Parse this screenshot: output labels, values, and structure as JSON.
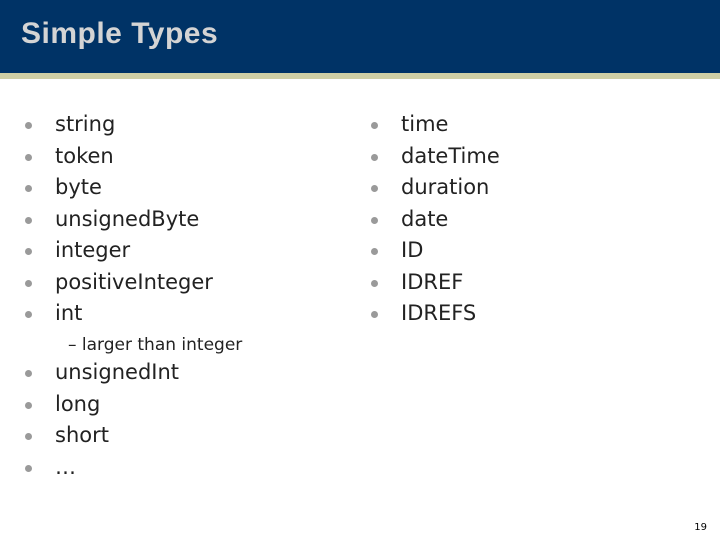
{
  "slide": {
    "title": "Simple Types",
    "page_number": "19",
    "colors": {
      "header": "#003366",
      "stripe": "#cfcfa5",
      "title": "#d4d4d4",
      "bullet": "#9a9a9a"
    }
  },
  "left_list": {
    "items": [
      "string",
      "token",
      "byte",
      "unsignedByte",
      "integer",
      "positiveInteger",
      "int"
    ],
    "sub_item": "– larger than integer",
    "items_after": [
      "unsignedInt",
      "long",
      "short",
      "…"
    ]
  },
  "right_list": {
    "items": [
      "time",
      "dateTime",
      "duration",
      "date",
      "ID",
      "IDREF",
      "IDREFS"
    ]
  }
}
